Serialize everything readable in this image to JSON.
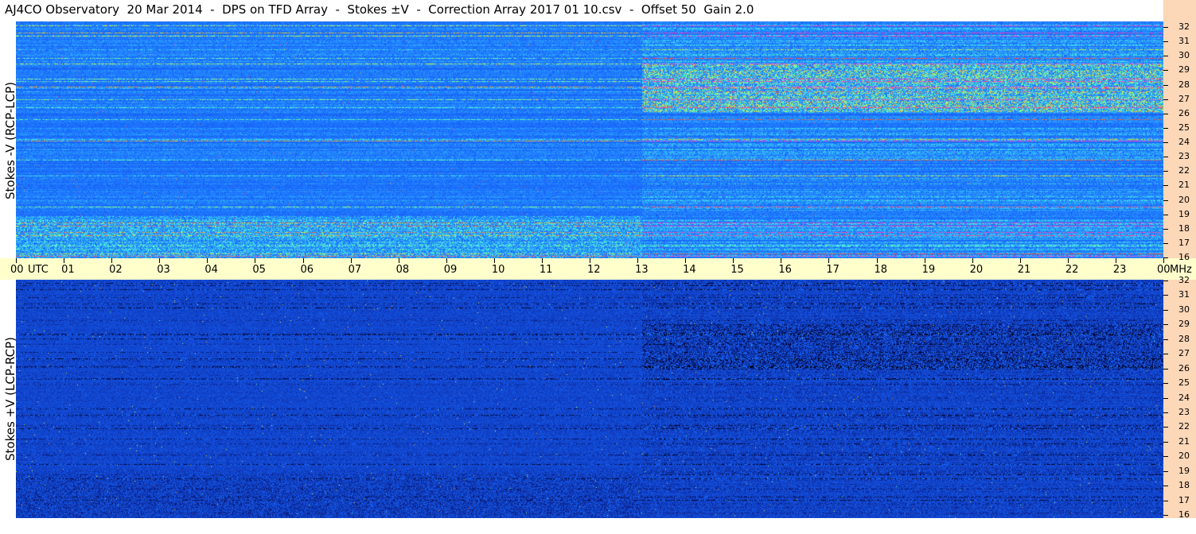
{
  "title": "AJ4CO Observatory  20 Mar 2014  -  DPS on TFD Array  -  Stokes ±V  -  Correction Array 2017 01 10.csv  -  Offset 50  Gain 2.0",
  "colors": {
    "background": "#ffffff",
    "time_axis_bg": "#ffffcc",
    "freq_axis_bg": "#fcd7b8",
    "colormap": [
      "#000020",
      "#0a1a7a",
      "#1040c8",
      "#1a6cff",
      "#30b0ff",
      "#50ffd0",
      "#d0ff40",
      "#ff5030",
      "#ff40c0"
    ]
  },
  "chart_data": [
    {
      "type": "heatmap",
      "panel": "top",
      "ylabel": "Stokes -V (RCP-LCP)",
      "xlabel": "UTC",
      "x_range_hours": [
        0,
        24
      ],
      "y_unit": "MHz",
      "ylim_mhz": [
        16,
        32
      ],
      "y_ticks": [
        "32",
        "31",
        "30",
        "29",
        "28",
        "27",
        "26",
        "25",
        "24",
        "23",
        "22",
        "21",
        "20",
        "19",
        "18",
        "17",
        "16"
      ],
      "x_ticks": [
        "00",
        "01",
        "02",
        "03",
        "04",
        "05",
        "06",
        "07",
        "08",
        "09",
        "10",
        "11",
        "12",
        "13",
        "14",
        "15",
        "16",
        "17",
        "18",
        "19",
        "20",
        "21",
        "22",
        "23",
        "00"
      ]
    },
    {
      "type": "heatmap",
      "panel": "bottom",
      "ylabel": "Stokes +V (LCP-RCP)",
      "xlabel": "UTC",
      "x_range_hours": [
        0,
        24
      ],
      "y_unit": "MHz",
      "ylim_mhz": [
        16,
        32
      ],
      "y_ticks": [
        "32",
        "31",
        "30",
        "29",
        "28",
        "27",
        "26",
        "25",
        "24",
        "23",
        "22",
        "21",
        "20",
        "19",
        "18",
        "17",
        "16"
      ],
      "x_ticks": [
        "00",
        "01",
        "02",
        "03",
        "04",
        "05",
        "06",
        "07",
        "08",
        "09",
        "10",
        "11",
        "12",
        "13",
        "14",
        "15",
        "16",
        "17",
        "18",
        "19",
        "20",
        "21",
        "22",
        "23",
        "00"
      ]
    }
  ],
  "time_axis": {
    "utc_label": "UTC",
    "mhz_label": "MHz"
  }
}
